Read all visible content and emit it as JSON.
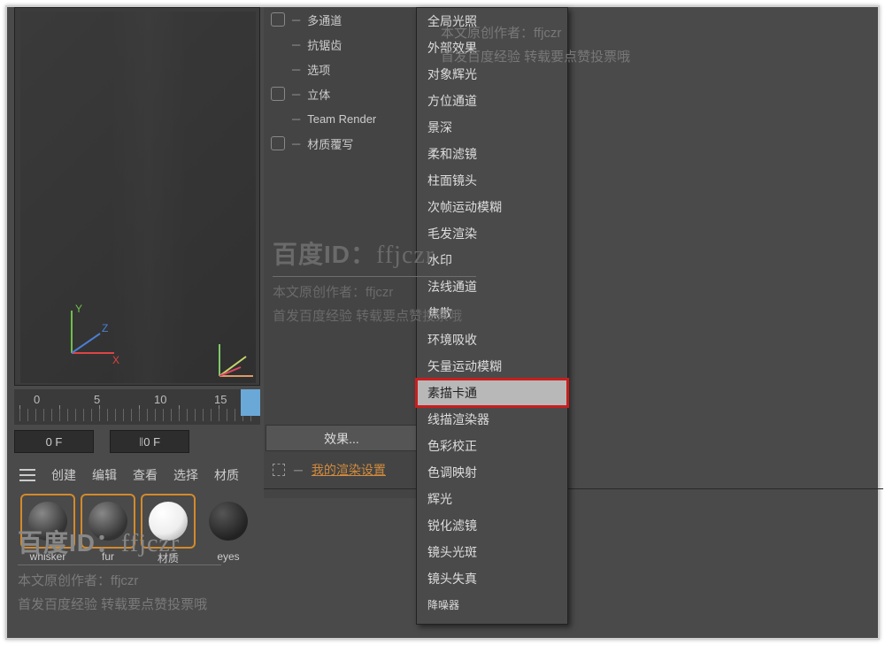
{
  "viewport": {
    "axis_x": "X",
    "axis_y": "Y",
    "axis_z": "Z"
  },
  "timeline": {
    "ticks": [
      "0",
      "5",
      "10",
      "15"
    ],
    "frame_left": "0 F",
    "frame_right": "0 F"
  },
  "material_menu": {
    "create": "创建",
    "edit": "编辑",
    "view": "查看",
    "select": "选择",
    "material": "材质"
  },
  "materials": [
    {
      "label": "whisker",
      "selected": true,
      "style": "grey"
    },
    {
      "label": "fur",
      "selected": true,
      "style": "grey"
    },
    {
      "label": "材质",
      "selected": true,
      "style": "white"
    },
    {
      "label": "eyes",
      "selected": false,
      "style": "dark"
    }
  ],
  "render_options": [
    {
      "label": "多通道",
      "checkbox": true
    },
    {
      "label": "抗锯齿",
      "checkbox": false
    },
    {
      "label": "选项",
      "checkbox": false
    },
    {
      "label": "立体",
      "checkbox": true
    },
    {
      "label": "Team Render",
      "checkbox": false
    },
    {
      "label": "材质覆写",
      "checkbox": true
    }
  ],
  "effects_button": "效果...",
  "my_render_settings": "我的渲染设置",
  "effects_menu": {
    "items": [
      "全局光照",
      "外部效果",
      "对象辉光",
      "方位通道",
      "景深",
      "柔和滤镜",
      "柱面镜头",
      "次帧运动模糊",
      "毛发渲染",
      "水印",
      "法线通道",
      "焦散",
      "环境吸收",
      "矢量运动模糊",
      "素描卡通",
      "线描渲染器",
      "色彩校正",
      "色调映射",
      "辉光",
      "锐化滤镜",
      "镜头光斑",
      "镜头失真",
      "降噪器"
    ],
    "highlighted": "素描卡通"
  },
  "watermark": {
    "big_prefix": "百度ID：",
    "big_id": "ffjczr",
    "line1": "本文原创作者：ffjczr",
    "line2": "首发百度经验 转载要点赞投票哦"
  }
}
